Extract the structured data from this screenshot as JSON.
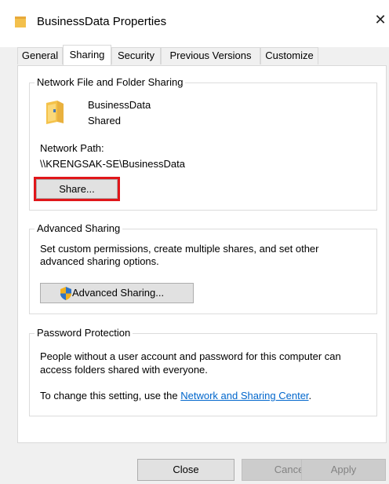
{
  "window": {
    "title": "BusinessData Properties",
    "close_glyph": "✕"
  },
  "tabs": [
    {
      "label": "General"
    },
    {
      "label": "Sharing"
    },
    {
      "label": "Security"
    },
    {
      "label": "Previous Versions"
    },
    {
      "label": "Customize"
    }
  ],
  "network_sharing": {
    "group_label": "Network File and Folder Sharing",
    "folder_name": "BusinessData",
    "folder_status": "Shared",
    "path_label": "Network Path:",
    "path_value": "\\\\KRENGSAK-SE\\BusinessData",
    "share_button": "Share..."
  },
  "advanced_sharing": {
    "group_label": "Advanced Sharing",
    "description_line1": "Set custom permissions, create multiple shares, and set other",
    "description_line2": "advanced sharing options.",
    "button_label": "Advanced Sharing..."
  },
  "password_protection": {
    "group_label": "Password Protection",
    "line1": "People without a user account and password for this computer can",
    "line2": "access folders shared with everyone.",
    "setting_prefix": "To change this setting, use the ",
    "link_text": "Network and Sharing Center",
    "setting_suffix": "."
  },
  "footer": {
    "close": "Close",
    "cancel": "Cancel",
    "apply": "Apply"
  },
  "colors": {
    "highlight": "#e0161a",
    "link": "#0066cc"
  }
}
